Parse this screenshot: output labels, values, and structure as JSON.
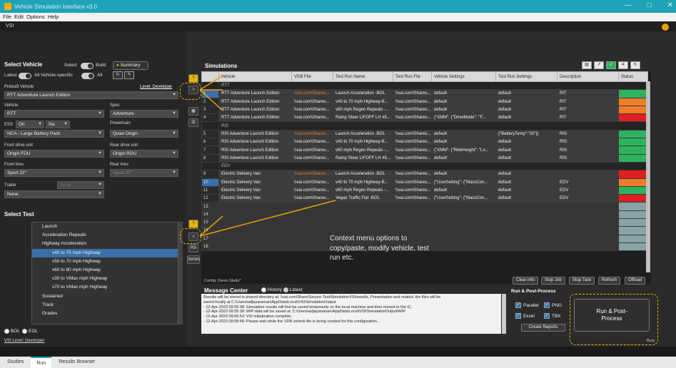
{
  "window": {
    "title": "Vehicle Simulation Interface v3.0",
    "minimize": "—",
    "maximize": "□",
    "close": "✕"
  },
  "menu": [
    "File",
    "Edit",
    "Options",
    "Help"
  ],
  "section_tab": "VSI",
  "select_vehicle": {
    "title": "Select Vehicle",
    "select_label": "Select",
    "build_label": "Build",
    "summary_label": "Summary",
    "latest_label": "Latest",
    "all_vehicle_specific": "All Vehicle-specific",
    "all_label": "All",
    "prebuilt_label": "Prebuilt Vehicle",
    "level_label": "Level: Developer",
    "prebuilt_value": "RTT Adventure Launch Edition",
    "vehicle_label": "Vehicle",
    "vehicle_value": "RTT",
    "spec_label": "Spec",
    "spec_value": "Adventure",
    "ess_label": "ESS",
    "ess_on": "On",
    "ess_na": "Na",
    "powertrain_label": "Powertrain",
    "ess_value": "NCA - Large Battery Pack",
    "powertrain_value": "Quad Origin",
    "front_drive_label": "Front drive unit",
    "front_drive_value": "Origin FDU",
    "rear_drive_label": "Rear drive unit",
    "rear_drive_value": "Origin RDU",
    "front_tires_label": "Front tires",
    "front_tires_value": "Sport 22\"",
    "rear_tires_label": "Rear tires",
    "rear_tires_value": "Sport 22\"",
    "trailer_label": "Trailer",
    "trailer_value": "None",
    "trailer_placeholder": "None"
  },
  "select_test": {
    "title": "Select Test",
    "items": [
      {
        "label": "Launch",
        "level": 0
      },
      {
        "label": "Acceleration Repeats",
        "level": 0
      },
      {
        "label": "Highway Acceleration",
        "level": 0
      },
      {
        "label": "v40 to 70 mph Highway",
        "level": 1,
        "selected": true
      },
      {
        "label": "v50 to 70 mph Highway",
        "level": 1
      },
      {
        "label": "v60 to 80 mph Highway",
        "level": 1
      },
      {
        "label": "v30 to VMax mph Highway",
        "level": 1
      },
      {
        "label": "v70 to VMax mph Highway",
        "level": 1
      },
      {
        "label": "Sustained",
        "level": 0
      },
      {
        "label": "Track",
        "level": 0
      },
      {
        "label": "Grades",
        "level": 0
      }
    ],
    "bol_label": "BOL",
    "eol_label": "EOL",
    "level_footer": "VSI Level: Developer"
  },
  "mid_buttons": [
    "?",
    ">",
    "?",
    "»",
    "RS",
    "Series"
  ],
  "simulations": {
    "title": "Simulations",
    "columns": [
      "Vehicle",
      "VDB File",
      "Test Run Name",
      "Test Run File",
      "Vehicle Settings",
      "Test Run Settings",
      "Description",
      "Status"
    ],
    "rows": [
      {
        "type": "group",
        "label": "RTT"
      },
      {
        "num": "1",
        "vehicle": "RTT Adventure Launch Edition",
        "vdb": "\\\\vai.com\\Shares...",
        "name": "Launch Acceleration -BOL",
        "file": "\\\\vai.com\\Shares...",
        "vset": "default",
        "tset": "default",
        "desc": "RIT",
        "status": "#2db35d"
      },
      {
        "num": "2",
        "vehicle": "RTT Adventure Launch Edition",
        "vdb": "\\\\vai.com\\Shares...",
        "name": "v40 to 70 mph Highway-B...",
        "file": "\\\\vai.com\\Shares...",
        "vset": "default",
        "tset": "default",
        "desc": "RIT",
        "status": "#f07d2a"
      },
      {
        "num": "3",
        "vehicle": "RTT Adventure Launch Edition",
        "vdb": "\\\\vai.com\\Shares...",
        "name": "v60 mph Regen Repeats -...",
        "file": "\\\\vai.com\\Shares...",
        "vset": "default",
        "tset": "default",
        "desc": "RIT",
        "status": "#f07d2a"
      },
      {
        "num": "4",
        "vehicle": "RTT Adventure Launch Edition",
        "vdb": "\\\\vai.com\\Shares...",
        "name": "Ramp Steer LIFOFF LH 45...",
        "file": "\\\\vai.com\\Shares...",
        "vset": "{\"XMM\": {\"DriveMode\": \"F...",
        "tset": "default",
        "desc": "RIT",
        "status": "#e02020"
      },
      {
        "type": "group",
        "label": "RIS"
      },
      {
        "num": "5",
        "vehicle": "RIS Adventure Launch Edition",
        "vdb": "\\\\vai.com\\Shares...",
        "name": "Launch Acceleration -BOL",
        "file": "\\\\vai.com\\Shares...",
        "vset": "default",
        "tset": "{\"BatteryTemp\":\"20\"}}",
        "desc": "RIS",
        "status": "#2db35d"
      },
      {
        "num": "6",
        "vehicle": "RIS Adventure Launch Edition",
        "vdb": "\\\\vai.com\\Shares...",
        "name": "v40 to 70 mph Highway-B...",
        "file": "\\\\vai.com\\Shares...",
        "vset": "default",
        "tset": "default",
        "desc": "RIS",
        "status": "#2db35d"
      },
      {
        "num": "7",
        "vehicle": "RIS Adventure Launch Edition",
        "vdb": "\\\\vai.com\\Shares...",
        "name": "v60 mph Regen Repeats -...",
        "file": "\\\\vai.com\\Shares...",
        "vset": "{\"XMM\": {\"RideHeight\": \"Lo...",
        "tset": "default",
        "desc": "RIS",
        "status": "#2db35d"
      },
      {
        "num": "8",
        "vehicle": "RIS Adventure Launch Edition",
        "vdb": "\\\\vai.com\\Shares...",
        "name": "Ramp Steer LIFOFF LH 45...",
        "file": "\\\\vai.com\\Shares...",
        "vset": "default",
        "tset": "default",
        "desc": "RIS",
        "status": "#2db35d"
      },
      {
        "type": "group",
        "label": "EDV"
      },
      {
        "num": "9",
        "vehicle": "Electric Delivery Van",
        "vdb": "\\\\vai.com\\Shares...",
        "name": "Launch Acceleration -BOL",
        "file": "\\\\vai.com\\Shares...",
        "vset": "default",
        "tset": "default",
        "desc": "",
        "status": "#e02020"
      },
      {
        "num": "10",
        "vehicle": "Electric Delivery Van",
        "vdb": "\\\\vai.com\\Shares...",
        "name": "v40 to 70 mph Highway-B...",
        "file": "\\\\vai.com\\Shares...",
        "vset": "{\"UserSetting\": {\"MassCon...",
        "tset": "default",
        "desc": "EDV",
        "status": "#f07d2a"
      },
      {
        "num": "11",
        "vehicle": "Electric Delivery Van",
        "vdb": "\\\\vai.com\\Shares...",
        "name": "v60 mph Regen Repeats -...",
        "file": "\\\\vai.com\\Shares...",
        "vset": "default",
        "tset": "default",
        "desc": "EDV",
        "status": "#2db35d"
      },
      {
        "num": "12",
        "vehicle": "Electric Delivery Van",
        "vdb": "\\\\vai.com\\Shares...",
        "name": "Vegas Traffic Flat -BOL",
        "file": "\\\\vai.com\\Shares...",
        "vset": "{\"UserSetting\": {\"MassCon...",
        "tset": "default",
        "desc": "EDV",
        "status": "#e02020"
      }
    ],
    "empty_nums": [
      "13",
      "14",
      "15",
      "16",
      "17",
      "18"
    ],
    "annotation": "Context menu options to copy/paste, modify vehicle, test run etc.",
    "config_label": "Config: Demo Study*"
  },
  "actions": [
    "Clear Info",
    "Stop Job",
    "Stop Task",
    "Refresh",
    "Offload"
  ],
  "message_center": {
    "title": "Message Center",
    "history_label": "History",
    "latest_label": "Latest",
    "lines": [
      "Results will be stored in shared directory at: \\\\vai.com\\Share\\Secure-Test\\SimulationVSI\\results. Presentation and related .tbx files will be",
      "saved locally at C:\\Users\\adjayaraman\\AppData\\Local\\VSI\\SimulationOutput",
      "- 12-Apr-2023 09:05:38: Simulation results will first be saved temporarily on the local machine and then moved to the IC.",
      "- 12-Apr-2023 09:05:38: WIP data will be saved at: C:\\Users\\adjayaraman\\AppData\\Local\\VSI\\SimulationOutput\\WIP",
      "- 12-Apr-2023 09:05:52: VSI initialization complete.",
      "- 12-Apr-2023 09:08:48: Please wait while the VDB vehicle file is being created for this configuration..."
    ]
  },
  "run_post": {
    "title": "Run & Post-Process",
    "parallel": "Parallel",
    "png": "PNG",
    "excel": "Excel",
    "tbx": "TBX",
    "create_reports": "Create Reports",
    "run_button": "Run & Post-Process",
    "status_text": "Busy"
  },
  "bottom_tabs": [
    "Studies",
    "Run",
    "Results Browser"
  ],
  "colors": {
    "accent": "#1fa3b8",
    "highlight": "#e8b400",
    "green": "#2db35d",
    "orange": "#f07d2a",
    "red": "#e02020"
  }
}
